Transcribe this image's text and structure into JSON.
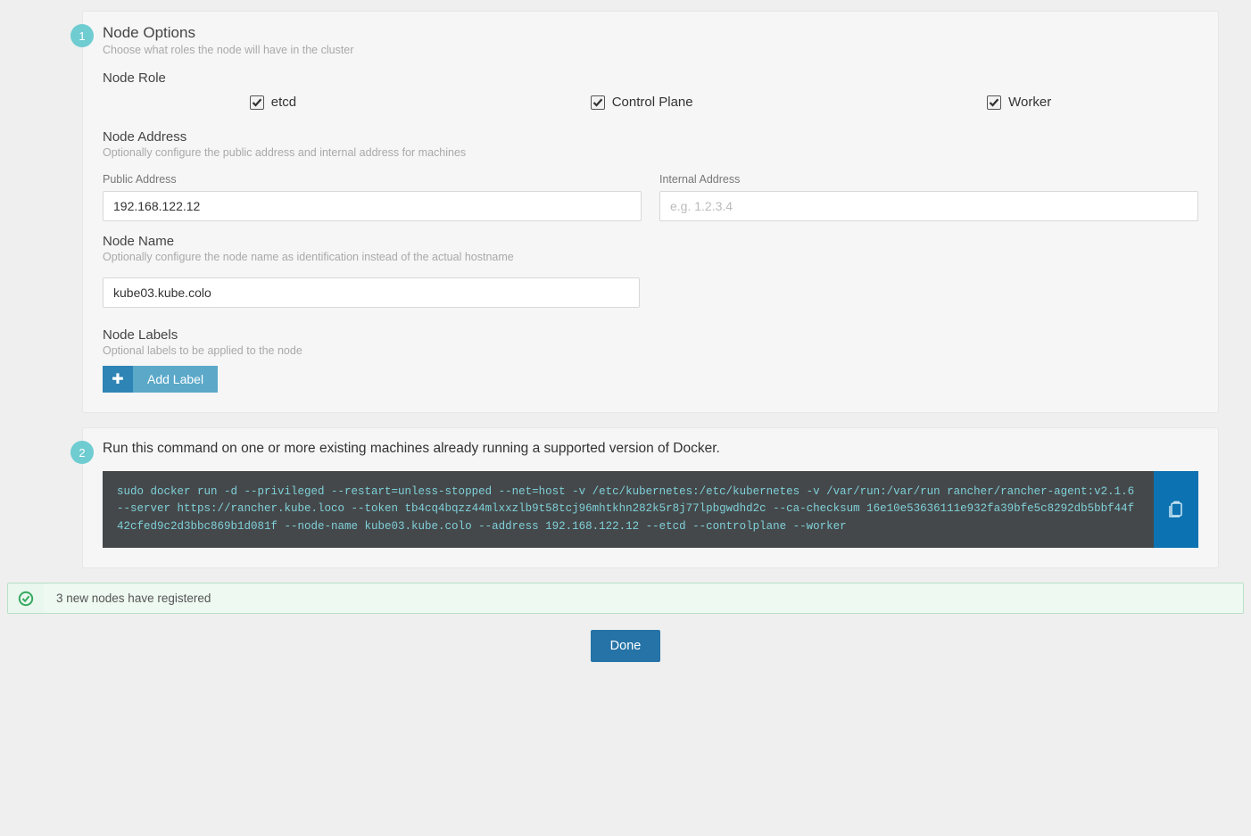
{
  "step1": {
    "badge": "1",
    "title": "Node Options",
    "desc": "Choose what roles the node will have in the cluster",
    "role": {
      "title": "Node Role",
      "options": {
        "etcd": "etcd",
        "control_plane": "Control Plane",
        "worker": "Worker"
      }
    },
    "address": {
      "title": "Node Address",
      "desc": "Optionally configure the public address and internal address for machines",
      "public_label": "Public Address",
      "public_value": "192.168.122.12",
      "internal_label": "Internal Address",
      "internal_placeholder": "e.g. 1.2.3.4"
    },
    "name": {
      "title": "Node Name",
      "desc": "Optionally configure the node name as identification instead of the actual hostname",
      "value": "kube03.kube.colo"
    },
    "labels": {
      "title": "Node Labels",
      "desc": "Optional labels to be applied to the node",
      "add_btn": "Add Label"
    }
  },
  "step2": {
    "badge": "2",
    "text": "Run this command on one or more existing machines already running a supported version of Docker.",
    "command": "sudo docker run -d --privileged --restart=unless-stopped --net=host -v /etc/kubernetes:/etc/kubernetes -v /var/run:/var/run rancher/rancher-agent:v2.1.6 --server https://rancher.kube.loco --token tb4cq4bqzz44mlxxzlb9t58tcj96mhtkhn282k5r8j77lpbgwdhd2c --ca-checksum 16e10e53636111e932fa39bfe5c8292db5bbf44f42cfed9c2d3bbc869b1d081f --node-name kube03.kube.colo --address 192.168.122.12 --etcd --controlplane --worker"
  },
  "notice": {
    "msg": "3 new nodes have registered"
  },
  "done_btn": "Done"
}
